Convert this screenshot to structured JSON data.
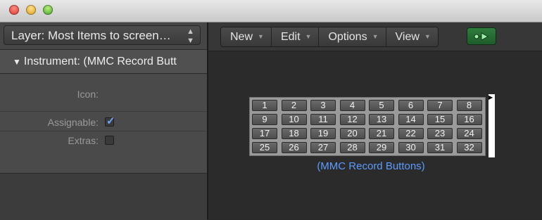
{
  "window": {
    "traffic_lights": [
      "close",
      "minimize",
      "maximize"
    ],
    "close_glyph": "×"
  },
  "left_panel": {
    "layer_label": "Layer: Most Items to screen…",
    "layer_arrows": "▲▼",
    "instrument_header": "Instrument: (MMC Record Butt",
    "properties": {
      "icon_label": "Icon:",
      "assignable_label": "Assignable:",
      "assignable_checked": true,
      "extras_label": "Extras:",
      "extras_checked": false
    }
  },
  "toolbar": {
    "menus": [
      "New",
      "Edit",
      "Options",
      "View"
    ],
    "link_icon": "link-arrow-icon",
    "accent_green": "#2f7d3e"
  },
  "environment": {
    "buttons": [
      "1",
      "2",
      "3",
      "4",
      "5",
      "6",
      "7",
      "8",
      "9",
      "10",
      "11",
      "12",
      "13",
      "14",
      "15",
      "16",
      "17",
      "18",
      "19",
      "20",
      "21",
      "22",
      "23",
      "24",
      "25",
      "26",
      "27",
      "28",
      "29",
      "30",
      "31",
      "32"
    ],
    "caption": "(MMC Record Buttons)",
    "caption_color": "#5c9bff"
  }
}
